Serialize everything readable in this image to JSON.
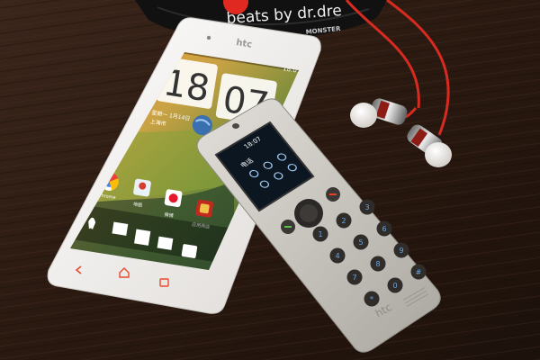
{
  "beats_case": {
    "brand_text": "beats by dr.dre",
    "maker_text": "MONSTER"
  },
  "smartphone": {
    "brand": "htc",
    "status_time": "18:07",
    "clock": {
      "hour": "18",
      "minute": "07"
    },
    "weather": {
      "date_line": "星期一 1月14日",
      "city": "上海市"
    },
    "app_labels": [
      "Chrome",
      "地图",
      "微博",
      "应用商店"
    ]
  },
  "mini_handset": {
    "brand": "htc",
    "status_time": "18:07",
    "screen_title": "电话",
    "keys": [
      {
        "digit": "1",
        "letters": ""
      },
      {
        "digit": "2",
        "letters": "ABC"
      },
      {
        "digit": "3",
        "letters": "DEF"
      },
      {
        "digit": "4",
        "letters": "GHI"
      },
      {
        "digit": "5",
        "letters": "JKL"
      },
      {
        "digit": "6",
        "letters": "MNO"
      },
      {
        "digit": "7",
        "letters": "PQRS"
      },
      {
        "digit": "8",
        "letters": "TUV"
      },
      {
        "digit": "9",
        "letters": "WXYZ"
      },
      {
        "digit": "*",
        "letters": ""
      },
      {
        "digit": "0",
        "letters": "+"
      },
      {
        "digit": "#",
        "letters": ""
      }
    ]
  },
  "colors": {
    "table": "#2a1a12",
    "phone_body": "#f2f0ee",
    "handset_body": "#cfccc7",
    "cable": "#d62b20",
    "accent_red": "#e54b2e",
    "key_blue": "#6aa6e6"
  }
}
